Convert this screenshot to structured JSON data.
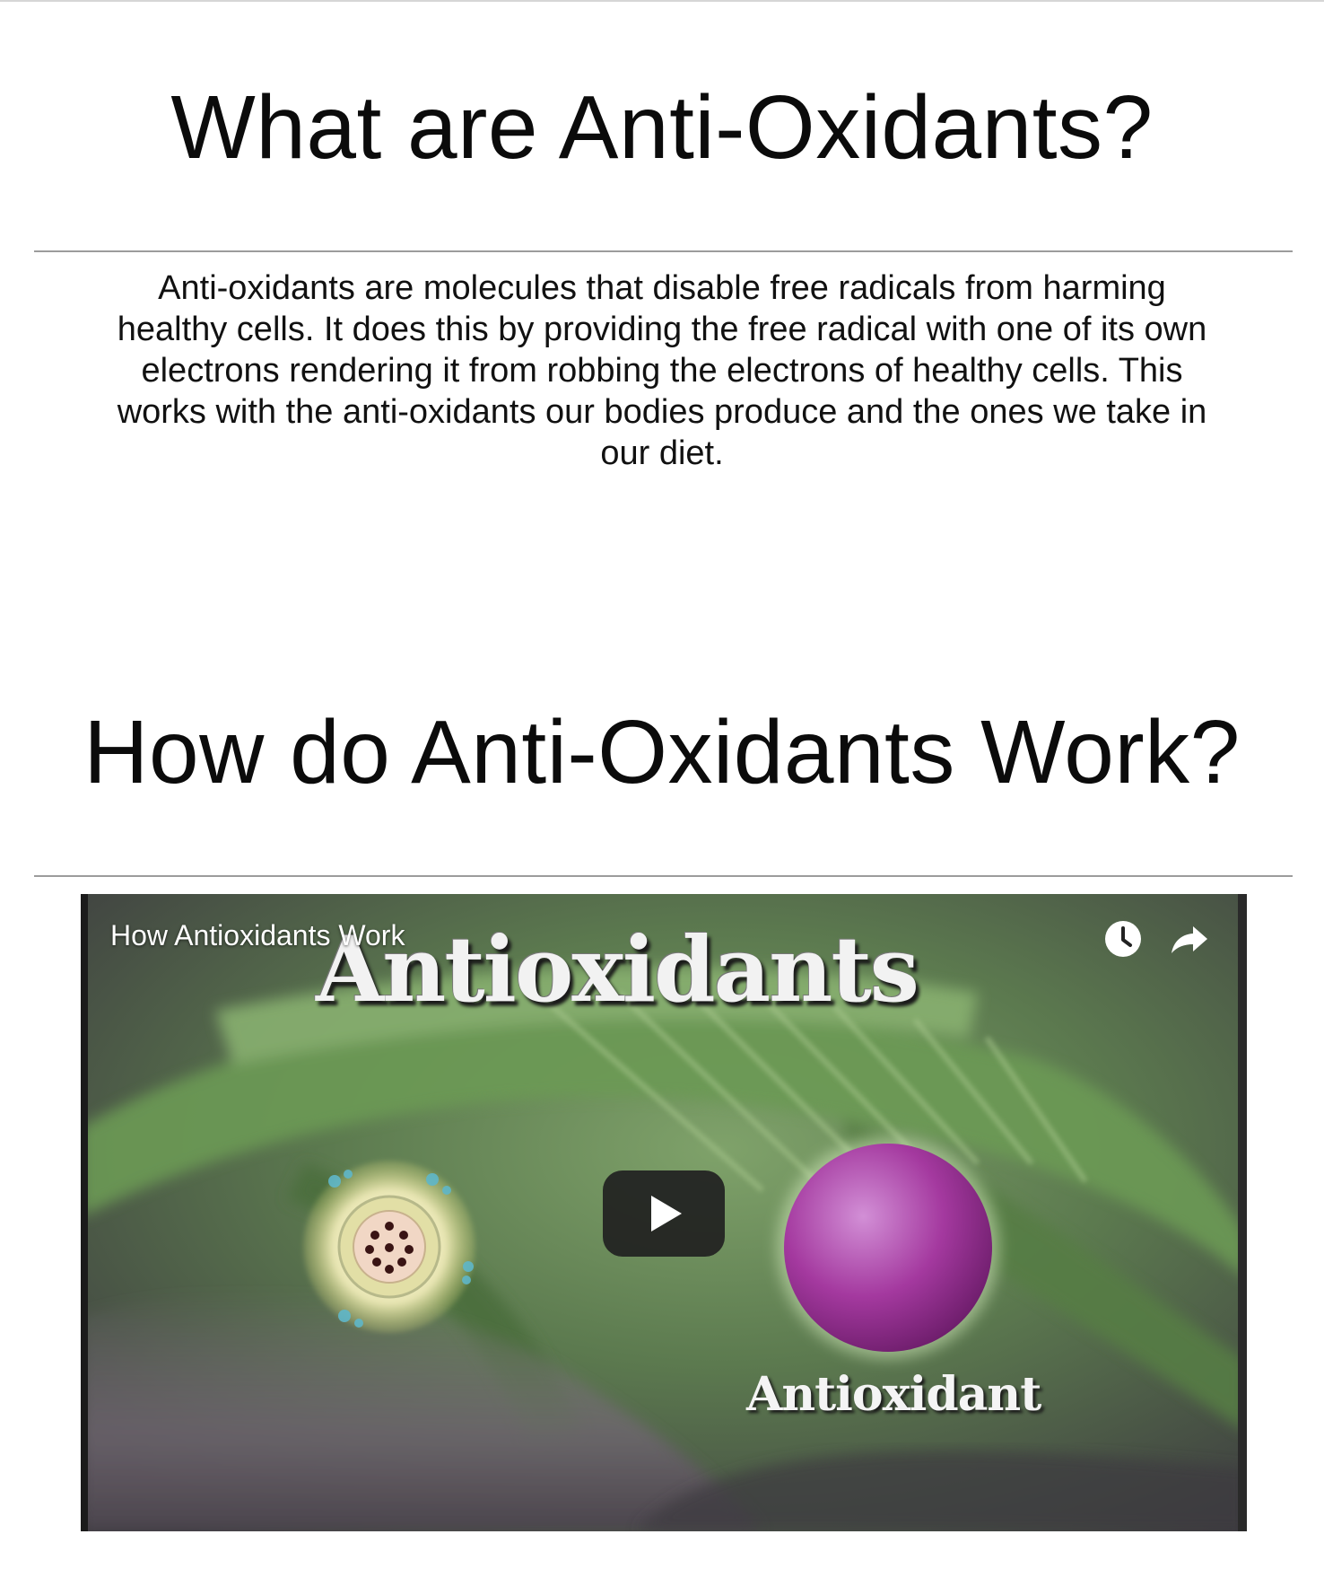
{
  "sections": [
    {
      "heading": "What are Anti-Oxidants?",
      "body": "Anti-oxidants are molecules that disable free radicals from harming healthy cells. It does this by providing the free radical with one of its own electrons rendering it from robbing the electrons of healthy cells. This works with the anti-oxidants our bodies produce and the ones we take in our diet."
    },
    {
      "heading": "How do Anti-Oxidants Work?"
    }
  ],
  "video": {
    "title": "How Antioxidants Work",
    "thumbnail_heading": "Antioxidants",
    "thumbnail_label": "Antioxidant",
    "controls": {
      "watch_later_icon": "clock-icon",
      "share_icon": "share-arrow-icon",
      "play_icon": "play-icon"
    }
  }
}
